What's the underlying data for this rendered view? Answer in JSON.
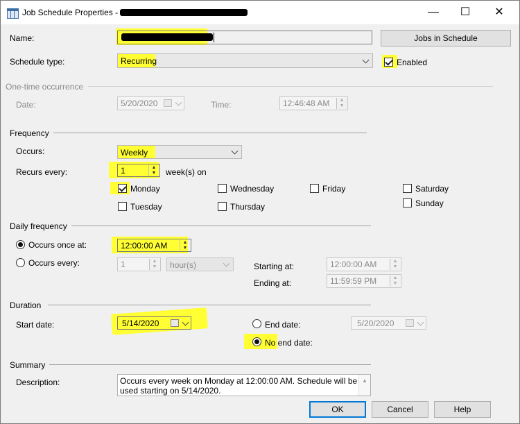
{
  "window": {
    "title": "Job Schedule Properties - ",
    "minimize": "—",
    "maximize": "☐",
    "close": "✕"
  },
  "name": {
    "label": "Name:",
    "jobs_button": "Jobs in Schedule"
  },
  "schedule_type": {
    "label": "Schedule type:",
    "value": "Recurring",
    "enabled_label": "Enabled",
    "enabled": true
  },
  "one_time": {
    "section": "One-time occurrence",
    "date_label": "Date:",
    "date_value": "5/20/2020",
    "time_label": "Time:",
    "time_value": "12:46:48 AM"
  },
  "frequency": {
    "section": "Frequency",
    "occurs_label": "Occurs:",
    "occurs_value": "Weekly",
    "recurs_label": "Recurs every:",
    "recurs_value": "1",
    "recurs_unit": "week(s) on",
    "days": {
      "monday": "Monday",
      "tuesday": "Tuesday",
      "wednesday": "Wednesday",
      "thursday": "Thursday",
      "friday": "Friday",
      "saturday": "Saturday",
      "sunday": "Sunday"
    }
  },
  "daily": {
    "section": "Daily frequency",
    "once_label": "Occurs once at:",
    "once_value": "12:00:00 AM",
    "every_label": "Occurs every:",
    "every_value": "1",
    "every_unit": "hour(s)",
    "starting_label": "Starting at:",
    "starting_value": "12:00:00 AM",
    "ending_label": "Ending at:",
    "ending_value": "11:59:59 PM"
  },
  "duration": {
    "section": "Duration",
    "start_label": "Start date:",
    "start_value": "5/14/2020",
    "end_label": "End date:",
    "end_value": "5/20/2020",
    "no_end_label": "No end date:"
  },
  "summary": {
    "section": "Summary",
    "description_label": "Description:",
    "line1": "Occurs every week on Monday at 12:00:00 AM. Schedule will be",
    "line2": "used starting on 5/14/2020."
  },
  "buttons": {
    "ok": "OK",
    "cancel": "Cancel",
    "help": "Help"
  },
  "colors": {
    "highlight": "#ffff33",
    "accent": "#0078d7"
  }
}
